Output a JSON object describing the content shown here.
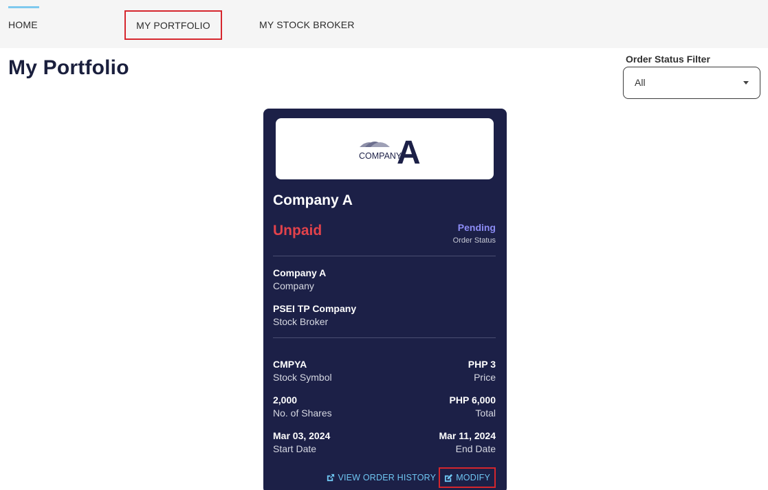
{
  "nav": {
    "items": [
      "HOME",
      "MY PORTFOLIO",
      "MY STOCK BROKER"
    ]
  },
  "page": {
    "title": "My Portfolio"
  },
  "filter": {
    "label": "Order Status Filter",
    "selected": "All"
  },
  "card": {
    "logo": {
      "word": "COMPANY",
      "letter": "A"
    },
    "company_name": "Company A",
    "payment_status": "Unpaid",
    "order_status": "Pending",
    "order_status_label": "Order Status",
    "company_value": "Company A",
    "company_label": "Company",
    "broker_value": "PSEI TP Company",
    "broker_label": "Stock Broker",
    "symbol_value": "CMPYA",
    "symbol_label": "Stock Symbol",
    "price_value": "PHP 3",
    "price_label": "Price",
    "shares_value": "2,000",
    "shares_label": "No. of Shares",
    "total_value": "PHP 6,000",
    "total_label": "Total",
    "start_value": "Mar 03, 2024",
    "start_label": "Start Date",
    "end_value": "Mar 11, 2024",
    "end_label": "End Date",
    "view_history_label": "VIEW ORDER HISTORY",
    "modify_label": "MODIFY"
  },
  "colors": {
    "card_bg": "#1c2047",
    "unpaid": "#e2424b",
    "pending": "#8c8cf5",
    "link": "#6fc6f2",
    "highlight": "#d6262d"
  }
}
